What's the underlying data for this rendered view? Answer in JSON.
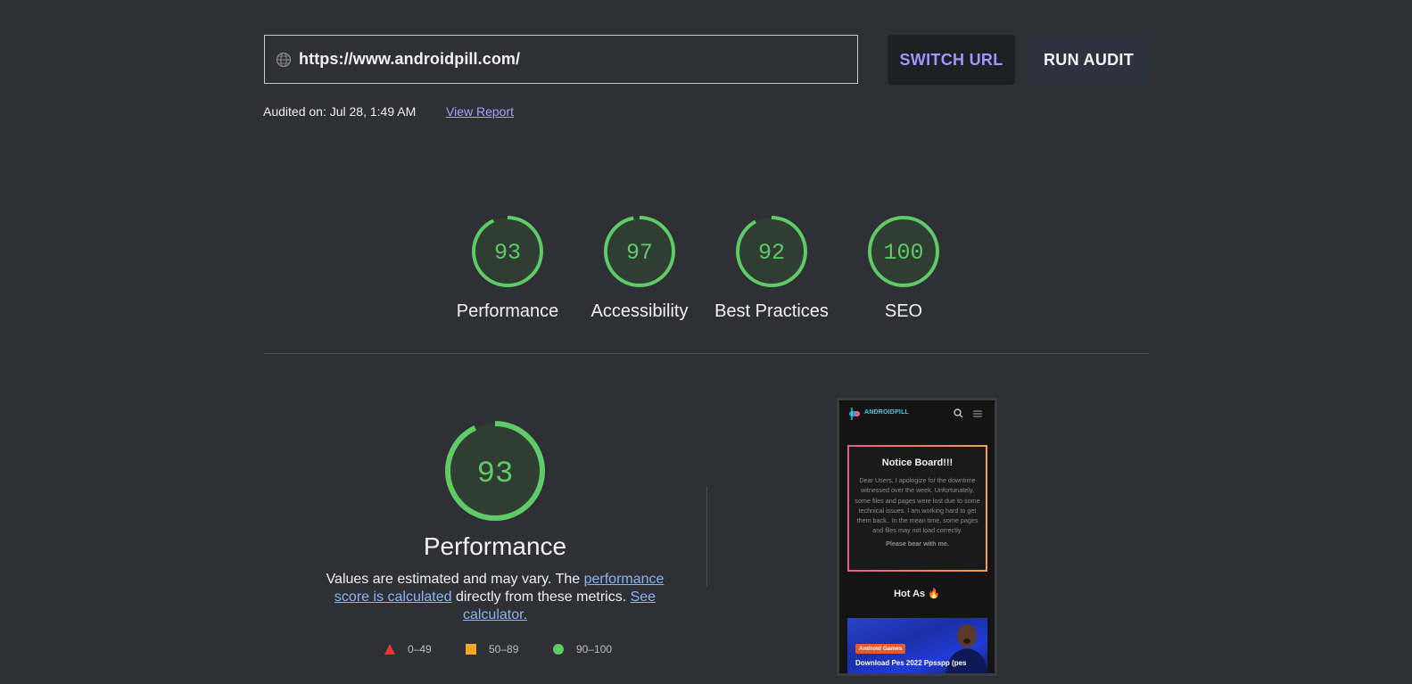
{
  "url_bar": {
    "value": "https://www.androidpill.com/",
    "icon": "globe-icon"
  },
  "buttons": {
    "switch_url": "SWITCH URL",
    "run_audit": "RUN AUDIT"
  },
  "audit": {
    "audited_on": "Audited on: Jul 28, 1:49 AM",
    "view_report": "View Report"
  },
  "scores": [
    {
      "score": "93",
      "label": "Performance"
    },
    {
      "score": "97",
      "label": "Accessibility"
    },
    {
      "score": "92",
      "label": "Best Practices"
    },
    {
      "score": "100",
      "label": "SEO"
    }
  ],
  "performance": {
    "score": "93",
    "title": "Performance",
    "desc_part1": "Values are estimated and may vary. The ",
    "desc_link1": "performance score is calculated",
    "desc_part2": " directly from these metrics. ",
    "desc_link2": "See calculator."
  },
  "legend": [
    {
      "label": "0–49",
      "color": "#e53935",
      "shape": "triangle"
    },
    {
      "label": "50–89",
      "color": "#f5a623",
      "shape": "square"
    },
    {
      "label": "90–100",
      "color": "#5ecb66",
      "shape": "circle"
    }
  ],
  "colors": {
    "pass": "#5ecb66",
    "gauge_fill": "#2f3d33",
    "accent_link": "#8ab4f8"
  },
  "thumbnail": {
    "brand": "ANDROIDPILL",
    "notice_title": "Notice Board!!!",
    "notice_body": "Dear Users, I apologize for the downtime witnessed over the week. Unfortunately, some files and pages were lost due to some technical issues. I am working hard to get them back.. In the mean time, some pages and files may not load correctly.",
    "notice_sign": "Please bear with me.",
    "hot_title": "Hot As 🔥",
    "card_tag": "Android Games",
    "card_title": "Download Pes 2022 Ppsspp (pes"
  }
}
